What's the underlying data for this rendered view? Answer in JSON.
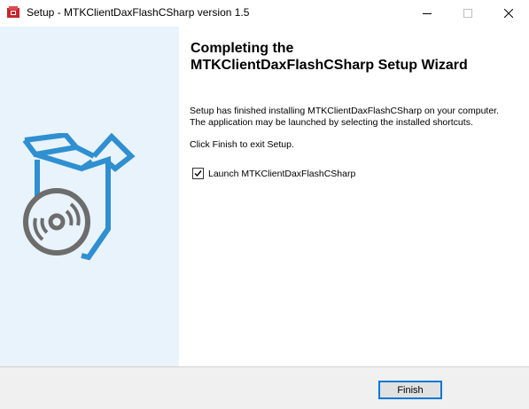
{
  "window": {
    "title": "Setup - MTKClientDaxFlashCSharp version 1.5",
    "icon": "setup-app-icon"
  },
  "caption_buttons": {
    "minimize_icon": "minimize-icon",
    "maximize_icon": "maximize-icon",
    "close_icon": "close-icon"
  },
  "side_panel": {
    "graphic": "box-with-disc-icon",
    "background_color": "#e8f3fb",
    "accent_color": "#2f8fd1"
  },
  "content": {
    "heading_line1": "Completing the",
    "heading_line2": "MTKClientDaxFlashCSharp Setup Wizard",
    "body_line1": "Setup has finished installing MTKClientDaxFlashCSharp on your computer.",
    "body_line2": "The application may be launched by selecting the installed shortcuts.",
    "finish_instruction": "Click Finish to exit Setup.",
    "launch_option": {
      "label": "Launch MTKClientDaxFlashCSharp",
      "checked": true
    }
  },
  "footer": {
    "finish_label": "Finish",
    "focus_color": "#0078d7"
  }
}
